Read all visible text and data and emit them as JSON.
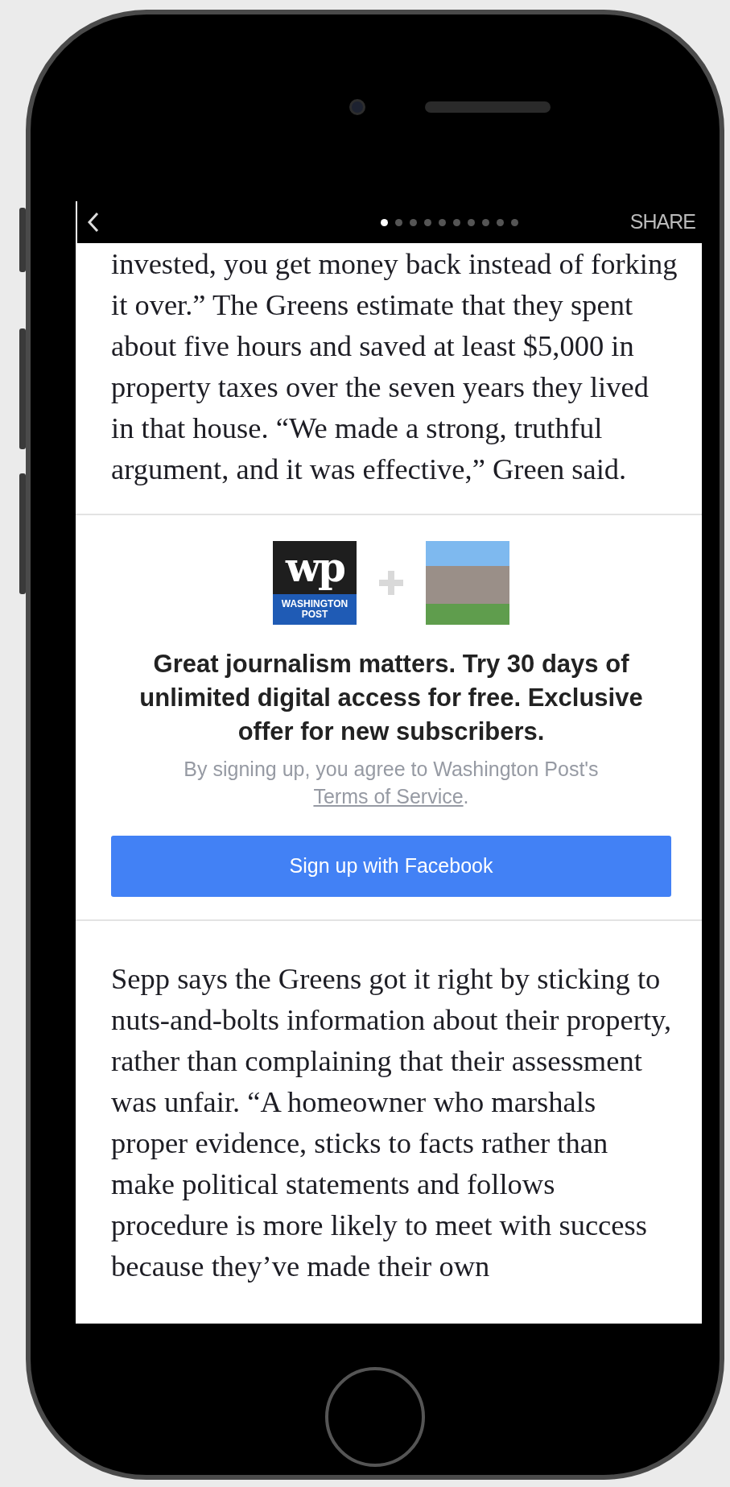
{
  "top_bar": {
    "pager": [
      {
        "selected": true
      },
      {
        "selected": false
      },
      {
        "selected": false
      },
      {
        "selected": false
      },
      {
        "selected": false
      },
      {
        "selected": false
      },
      {
        "selected": false
      },
      {
        "selected": false
      },
      {
        "selected": false
      },
      {
        "selected": false
      }
    ],
    "share": "SHARE"
  },
  "paragraphs_before": [
    "invested, you get money back instead of forking it over.” The Greens estimate that they spent about five hours and saved at least $5,000 in property taxes over the seven years they lived in that house. “We made a strong, truthful argument, and it was effective,” Green said."
  ],
  "promo": {
    "logo_mark": "wp",
    "logo_text": "WASHINGTON POST",
    "headline": "Great journalism matters. Try 30 days of unlimited digital access for free. Exclusive offer for new subscribers.",
    "terms_text": "By signing up, you agree to Washington Post's",
    "terms_link": "Terms of Service",
    "terms_end": ".",
    "button": "Sign up with Facebook"
  },
  "paragraphs_after": [
    "Sepp says the Greens got it right by sticking to nuts-and-bolts information about their property, rather than complaining that their assessment was unfair. “A homeowner who marshals proper evidence, sticks to facts rather than make political statements and follows procedure is more likely to meet with success because they’ve made their own"
  ]
}
